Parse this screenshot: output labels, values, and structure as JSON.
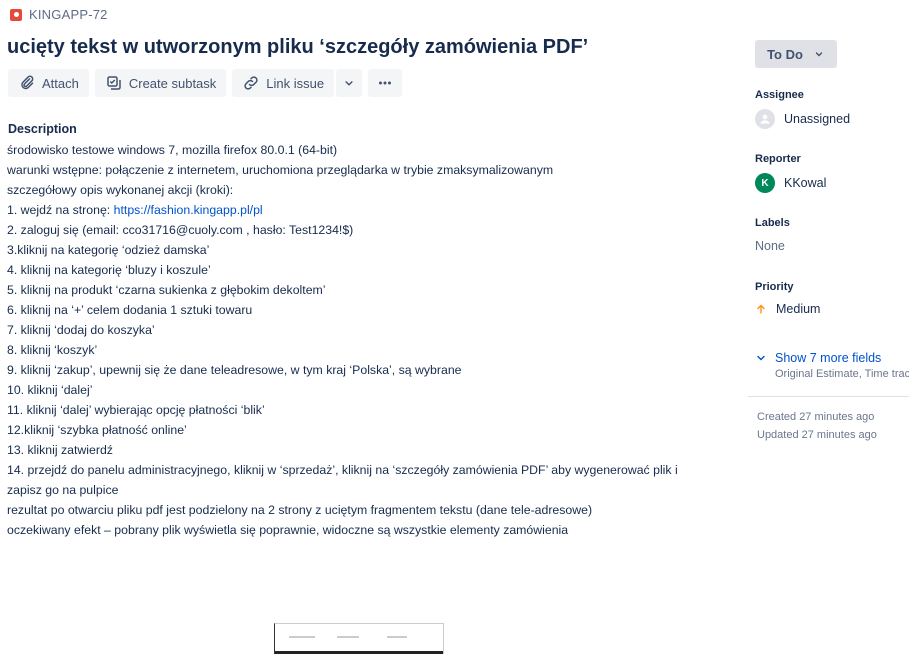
{
  "header": {
    "issue_key": "KINGAPP-72",
    "title": "ucięty tekst w utworzonym pliku ‘szczegóły zamówienia PDF’"
  },
  "toolbar": {
    "attach_label": "Attach",
    "create_subtask_label": "Create subtask",
    "link_issue_label": "Link issue"
  },
  "description": {
    "heading": "Description",
    "lines": [
      "środowisko testowe windows 7, mozilla firefox 80.0.1 (64-bit)",
      "warunki wstępne: połączenie z internetem, uruchomiona przeglądarka w trybie zmaksymalizowanym",
      "szczegółowy opis wykonanej akcji (kroki):",
      "1. wejdź na stronę: ",
      "2. zaloguj się (email: cco31716@cuoly.com , hasło: Test1234!$)",
      "3.kliknij na kategorię ‘odzież damska’",
      "4. kliknij na kategorię ‘bluzy i koszule’",
      "5. kliknij na produkt ‘czarna sukienka z głębokim dekoltem’",
      "6. kliknij na ‘+’ celem dodania 1 sztuki towaru",
      "7.  kliknij ‘dodaj do koszyka’",
      "8. kliknij ‘koszyk’",
      "9. kliknij ‘zakup’, upewnij się że dane teleadresowe, w tym kraj ‘Polska’, są wybrane",
      "10. kliknij ‘dalej’",
      "11. kliknij ‘dalej’ wybierając opcję płatności ‘blik’",
      "12.kliknij ‘szybka płatność online’",
      "13. kliknij zatwierdź",
      "14. przejdź do panelu administracyjnego, kliknij w ‘sprzedaż’, kliknij na ‘szczegóły zamówienia PDF’ aby wygenerować plik i",
      "zapisz go na pulpice",
      "rezultat po otwarciu pliku pdf jest podzielony na 2 strony z uciętym  fragmentem tekstu (dane tele-adresowe)",
      "oczekiwany efekt – pobrany plik wyświetla się poprawnie, widoczne są wszystkie elementy zamówienia"
    ],
    "link": "https://fashion.kingapp.pl/pl"
  },
  "sidebar": {
    "status": "To Do",
    "assignee_label": "Assignee",
    "assignee_value": "Unassigned",
    "reporter_label": "Reporter",
    "reporter_initial": "K",
    "reporter_value": "KKowal",
    "labels_label": "Labels",
    "labels_value": "None",
    "priority_label": "Priority",
    "priority_value": "Medium",
    "show_more": "Show 7 more fields",
    "show_more_sub": "Original Estimate, Time tracking",
    "created": "Created 27 minutes ago",
    "updated": "Updated 27 minutes ago"
  },
  "colors": {
    "link": "#0052cc",
    "bug": "#e5493a",
    "priority_medium": "#ff8b00",
    "reporter_avatar": "#00875a"
  }
}
